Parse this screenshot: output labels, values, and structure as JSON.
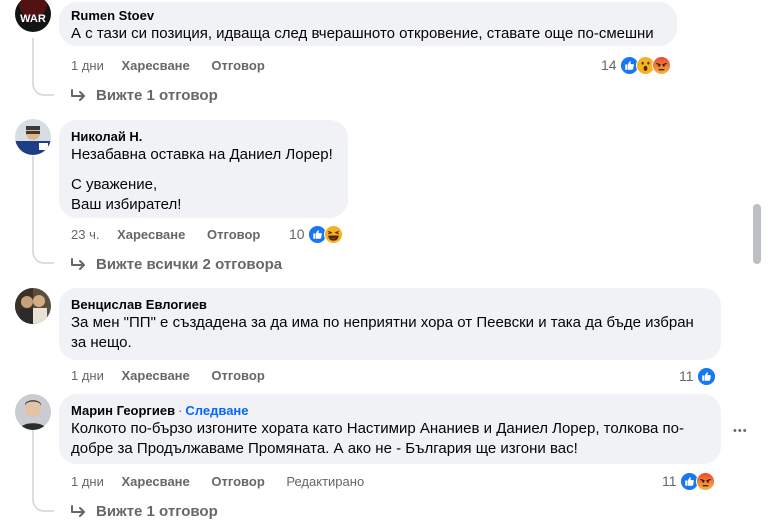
{
  "comments": [
    {
      "author": "Rumen Stoev",
      "lines": [
        "А с тази си позиция, идваща след вчерашното откровение, ставате още по-смешни"
      ],
      "age": "1 дни",
      "like": "Харесване",
      "reply": "Отговор",
      "reaction_count": "14",
      "reactions": [
        "like-icon",
        "wow-icon",
        "angry-icon"
      ],
      "view_replies": "Вижте 1 отговор",
      "avatar_text": "WAR"
    },
    {
      "author": "Николай Н.",
      "lines": [
        "Незабавна оставка на Даниел Лорер!",
        "",
        "С уважение,",
        "Ваш избирател!"
      ],
      "age": "23 ч.",
      "like": "Харесване",
      "reply": "Отговор",
      "reaction_count": "10",
      "reactions": [
        "like-icon",
        "haha-icon"
      ],
      "view_replies": "Вижте всички 2 отговора"
    },
    {
      "author": "Венцислав Евлогиев",
      "lines": [
        "За мен \"ПП\" е създадена за да има по неприятни хора от Пеевски и така да бъде избран",
        "за нещо."
      ],
      "age": "1 дни",
      "like": "Харесване",
      "reply": "Отговор",
      "reaction_count": "11",
      "reactions": [
        "like-icon"
      ]
    },
    {
      "author": "Марин Георгиев",
      "follow": "Следване",
      "lines": [
        "Колкото по-бързо изгоните хората като Настимир Ананиев и Даниел Лорер, толкова по-",
        "добре за Продължаваме Промяната. А ако не - България ще изгони вас!"
      ],
      "age": "1 дни",
      "like": "Харесване",
      "reply": "Отговор",
      "edited": "Редактирано",
      "reaction_count": "11",
      "reactions": [
        "like-icon",
        "angry-icon"
      ],
      "view_replies": "Вижте 1 отговор",
      "more": "•••"
    }
  ],
  "colors": {
    "bubble": "#f0f2f5",
    "secondary_text": "#65676b",
    "accent": "#0866ff",
    "like": "#1877f2",
    "angry": "#f0533c",
    "wow_haha": "#f7b125"
  }
}
